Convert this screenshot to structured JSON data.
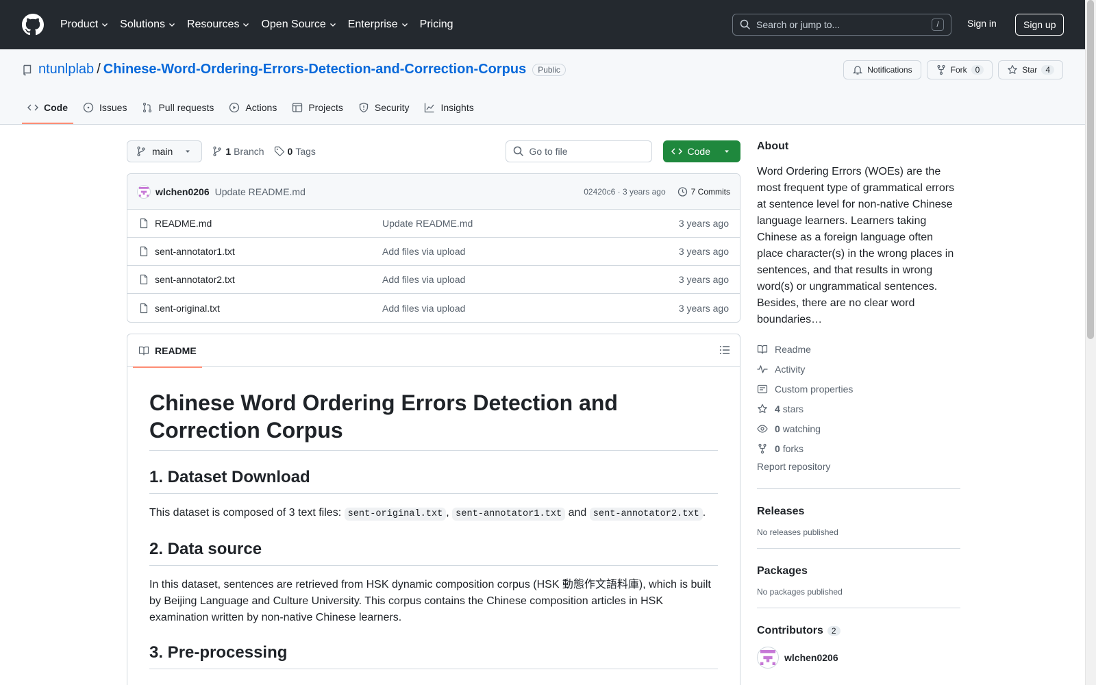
{
  "header": {
    "nav": [
      "Product",
      "Solutions",
      "Resources",
      "Open Source",
      "Enterprise",
      "Pricing"
    ],
    "search_placeholder": "Search or jump to...",
    "search_shortcut": "/",
    "signin": "Sign in",
    "signup": "Sign up"
  },
  "repo": {
    "owner": "ntunlplab",
    "separator": "/",
    "name": "Chinese-Word-Ordering-Errors-Detection-and-Correction-Corpus",
    "visibility": "Public",
    "notifications": "Notifications",
    "fork_label": "Fork",
    "fork_count": "0",
    "star_label": "Star",
    "star_count": "4",
    "tabs": [
      "Code",
      "Issues",
      "Pull requests",
      "Actions",
      "Projects",
      "Security",
      "Insights"
    ]
  },
  "toolbar": {
    "branch": "main",
    "branch_count": "1",
    "branch_label": "Branch",
    "tag_count": "0",
    "tag_label": "Tags",
    "goto_placeholder": "Go to file",
    "code_button": "Code"
  },
  "commit": {
    "author": "wlchen0206",
    "message": "Update README.md",
    "hash_time": "02420c6 · 3 years ago",
    "commits": "7 Commits"
  },
  "files": [
    {
      "name": "README.md",
      "message": "Update README.md",
      "age": "3 years ago"
    },
    {
      "name": "sent-annotator1.txt",
      "message": "Add files via upload",
      "age": "3 years ago"
    },
    {
      "name": "sent-annotator2.txt",
      "message": "Add files via upload",
      "age": "3 years ago"
    },
    {
      "name": "sent-original.txt",
      "message": "Add files via upload",
      "age": "3 years ago"
    }
  ],
  "readme": {
    "tab": "README",
    "title": "Chinese Word Ordering Errors Detection and Correction Corpus",
    "h_download": "1. Dataset Download",
    "p_download_1": "This dataset is composed of 3 text files: ",
    "code_1": "sent-original.txt",
    "comma": ", ",
    "code_2": "sent-annotator1.txt",
    "and": " and ",
    "code_3": "sent-annotator2.txt",
    "period": ".",
    "h_source": "2. Data source",
    "p_source": "In this dataset, sentences are retrieved from HSK dynamic composition corpus (HSK 動態作文語料庫), which is built by Beijing Language and Culture University. This corpus contains the Chinese composition articles in HSK examination written by non-native Chinese learners.",
    "h_pre": "3. Pre-processing"
  },
  "sidebar": {
    "about_title": "About",
    "about_text": "Word Ordering Errors (WOEs) are the most frequent type of grammatical errors at sentence level for non-native Chinese language learners. Learners taking Chinese as a foreign language often place character(s) in the wrong places in sentences, and that results in wrong word(s) or ungrammatical sentences. Besides, there are no clear word boundaries…",
    "readme": "Readme",
    "activity": "Activity",
    "custom_properties": "Custom properties",
    "stars_count": "4",
    "stars_label": "stars",
    "watching_count": "0",
    "watching_label": "watching",
    "forks_count": "0",
    "forks_label": "forks",
    "report": "Report repository",
    "releases_title": "Releases",
    "releases_empty": "No releases published",
    "packages_title": "Packages",
    "packages_empty": "No packages published",
    "contributors_title": "Contributors",
    "contributors_count": "2",
    "contributor_1": "wlchen0206"
  },
  "colors": {
    "header_bg": "#24292f",
    "link": "#0969da",
    "code_button": "#1f883d",
    "tab_underline": "#fd8c73"
  }
}
